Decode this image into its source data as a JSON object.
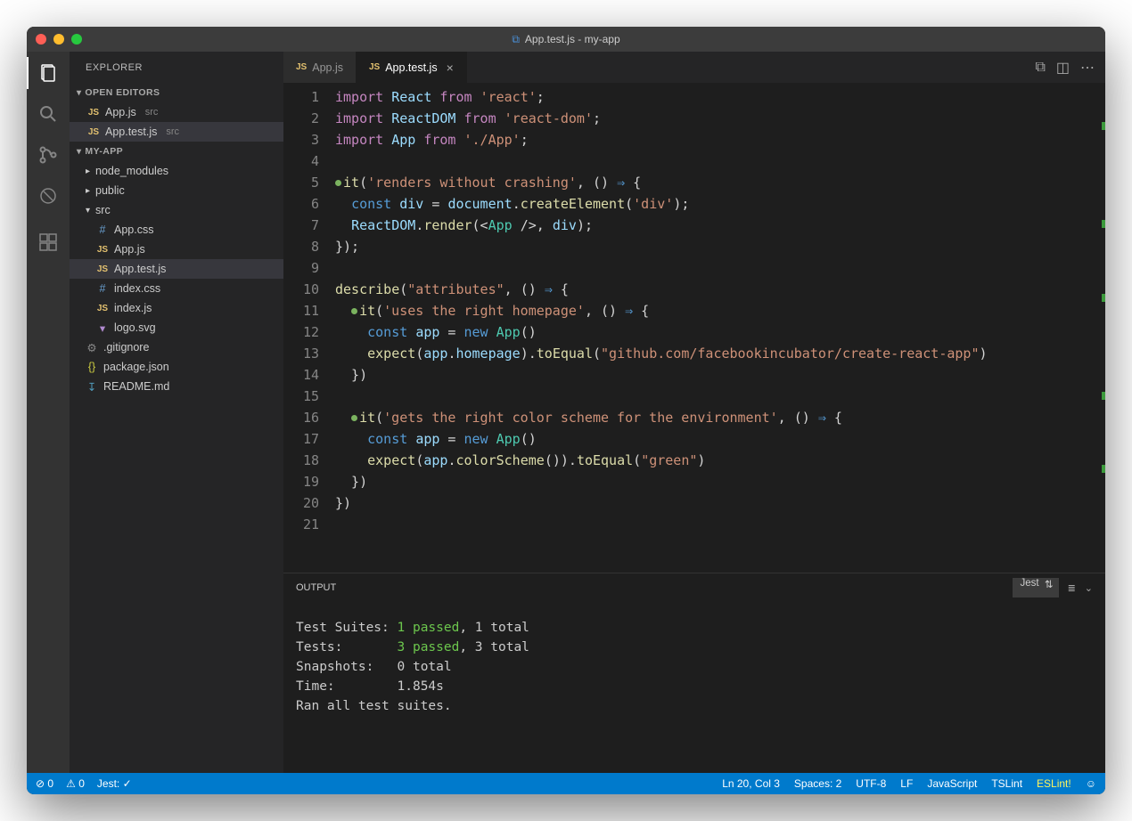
{
  "window": {
    "title": "App.test.js - my-app"
  },
  "sidebar": {
    "header": "EXPLORER",
    "sections": {
      "openEditors": {
        "title": "OPEN EDITORS",
        "items": [
          {
            "icon": "JS",
            "name": "App.js",
            "hint": "src"
          },
          {
            "icon": "JS",
            "name": "App.test.js",
            "hint": "src"
          }
        ]
      },
      "project": {
        "title": "MY-APP",
        "tree": [
          {
            "type": "folder",
            "name": "node_modules",
            "depth": 0
          },
          {
            "type": "folder",
            "name": "public",
            "depth": 0
          },
          {
            "type": "folder",
            "name": "src",
            "depth": 0,
            "open": true
          },
          {
            "type": "file",
            "icon": "#",
            "name": "App.css",
            "depth": 1
          },
          {
            "type": "file",
            "icon": "JS",
            "name": "App.js",
            "depth": 1
          },
          {
            "type": "file",
            "icon": "JS",
            "name": "App.test.js",
            "depth": 1,
            "selected": true
          },
          {
            "type": "file",
            "icon": "#",
            "name": "index.css",
            "depth": 1
          },
          {
            "type": "file",
            "icon": "JS",
            "name": "index.js",
            "depth": 1
          },
          {
            "type": "file",
            "icon": "svg",
            "name": "logo.svg",
            "depth": 1
          },
          {
            "type": "file",
            "icon": "git",
            "name": ".gitignore",
            "depth": 0
          },
          {
            "type": "file",
            "icon": "{}",
            "name": "package.json",
            "depth": 0
          },
          {
            "type": "file",
            "icon": "↓",
            "name": "README.md",
            "depth": 0
          }
        ]
      }
    }
  },
  "tabs": [
    {
      "icon": "JS",
      "label": "App.js",
      "active": false
    },
    {
      "icon": "JS",
      "label": "App.test.js",
      "active": true
    }
  ],
  "code": {
    "lines": [
      [
        {
          "c": "k-import",
          "t": "import"
        },
        {
          "t": " "
        },
        {
          "c": "k-var",
          "t": "React"
        },
        {
          "t": " "
        },
        {
          "c": "k-import",
          "t": "from"
        },
        {
          "t": " "
        },
        {
          "c": "k-str",
          "t": "'react'"
        },
        {
          "t": ";"
        }
      ],
      [
        {
          "c": "k-import",
          "t": "import"
        },
        {
          "t": " "
        },
        {
          "c": "k-var",
          "t": "ReactDOM"
        },
        {
          "t": " "
        },
        {
          "c": "k-import",
          "t": "from"
        },
        {
          "t": " "
        },
        {
          "c": "k-str",
          "t": "'react-dom'"
        },
        {
          "t": ";"
        }
      ],
      [
        {
          "c": "k-import",
          "t": "import"
        },
        {
          "t": " "
        },
        {
          "c": "k-var",
          "t": "App"
        },
        {
          "t": " "
        },
        {
          "c": "k-import",
          "t": "from"
        },
        {
          "t": " "
        },
        {
          "c": "k-str",
          "t": "'./App'"
        },
        {
          "t": ";"
        }
      ],
      [],
      [
        {
          "dot": true
        },
        {
          "c": "k-fn",
          "t": "it"
        },
        {
          "t": "("
        },
        {
          "c": "k-str",
          "t": "'renders without crashing'"
        },
        {
          "t": ", () "
        },
        {
          "c": "k-kw",
          "t": "⇒"
        },
        {
          "t": " {"
        }
      ],
      [
        {
          "t": "  "
        },
        {
          "c": "k-kw",
          "t": "const"
        },
        {
          "t": " "
        },
        {
          "c": "k-var",
          "t": "div"
        },
        {
          "t": " = "
        },
        {
          "c": "k-var",
          "t": "document"
        },
        {
          "t": "."
        },
        {
          "c": "k-fn",
          "t": "createElement"
        },
        {
          "t": "("
        },
        {
          "c": "k-str",
          "t": "'div'"
        },
        {
          "t": ");"
        }
      ],
      [
        {
          "t": "  "
        },
        {
          "c": "k-var",
          "t": "ReactDOM"
        },
        {
          "t": "."
        },
        {
          "c": "k-fn",
          "t": "render"
        },
        {
          "t": "(<"
        },
        {
          "c": "k-tag",
          "t": "App"
        },
        {
          "t": " />, "
        },
        {
          "c": "k-var",
          "t": "div"
        },
        {
          "t": ");"
        }
      ],
      [
        {
          "t": "});"
        }
      ],
      [],
      [
        {
          "c": "k-fn",
          "t": "describe"
        },
        {
          "t": "("
        },
        {
          "c": "k-str",
          "t": "\"attributes\""
        },
        {
          "t": ", () "
        },
        {
          "c": "k-kw",
          "t": "⇒"
        },
        {
          "t": " {"
        }
      ],
      [
        {
          "t": "  "
        },
        {
          "dot": true
        },
        {
          "c": "k-fn",
          "t": "it"
        },
        {
          "t": "("
        },
        {
          "c": "k-str",
          "t": "'uses the right homepage'"
        },
        {
          "t": ", () "
        },
        {
          "c": "k-kw",
          "t": "⇒"
        },
        {
          "t": " {"
        }
      ],
      [
        {
          "t": "    "
        },
        {
          "c": "k-kw",
          "t": "const"
        },
        {
          "t": " "
        },
        {
          "c": "k-var",
          "t": "app"
        },
        {
          "t": " = "
        },
        {
          "c": "k-kw",
          "t": "new"
        },
        {
          "t": " "
        },
        {
          "c": "k-type",
          "t": "App"
        },
        {
          "t": "()"
        }
      ],
      [
        {
          "t": "    "
        },
        {
          "c": "k-fn",
          "t": "expect"
        },
        {
          "t": "("
        },
        {
          "c": "k-var",
          "t": "app"
        },
        {
          "t": "."
        },
        {
          "c": "k-var",
          "t": "homepage"
        },
        {
          "t": ")."
        },
        {
          "c": "k-fn",
          "t": "toEqual"
        },
        {
          "t": "("
        },
        {
          "c": "k-str",
          "t": "\"github.com/facebookincubator/create-react-app\""
        },
        {
          "t": ")"
        }
      ],
      [
        {
          "t": "  })"
        }
      ],
      [],
      [
        {
          "t": "  "
        },
        {
          "dot": true
        },
        {
          "c": "k-fn",
          "t": "it"
        },
        {
          "t": "("
        },
        {
          "c": "k-str",
          "t": "'gets the right color scheme for the environment'"
        },
        {
          "t": ", () "
        },
        {
          "c": "k-kw",
          "t": "⇒"
        },
        {
          "t": " {"
        }
      ],
      [
        {
          "t": "    "
        },
        {
          "c": "k-kw",
          "t": "const"
        },
        {
          "t": " "
        },
        {
          "c": "k-var",
          "t": "app"
        },
        {
          "t": " = "
        },
        {
          "c": "k-kw",
          "t": "new"
        },
        {
          "t": " "
        },
        {
          "c": "k-type",
          "t": "App"
        },
        {
          "t": "()"
        }
      ],
      [
        {
          "t": "    "
        },
        {
          "c": "k-fn",
          "t": "expect"
        },
        {
          "t": "("
        },
        {
          "c": "k-var",
          "t": "app"
        },
        {
          "t": "."
        },
        {
          "c": "k-fn",
          "t": "colorScheme"
        },
        {
          "t": "())."
        },
        {
          "c": "k-fn",
          "t": "toEqual"
        },
        {
          "t": "("
        },
        {
          "c": "k-str",
          "t": "\"green\""
        },
        {
          "t": ")"
        }
      ],
      [
        {
          "t": "  })"
        }
      ],
      [
        {
          "t": "})"
        }
      ],
      []
    ]
  },
  "output": {
    "title": "OUTPUT",
    "channel": "Jest",
    "lines": [
      {
        "label": "Test Suites: ",
        "pass": "1 passed",
        "rest": ", 1 total"
      },
      {
        "label": "Tests:       ",
        "pass": "3 passed",
        "rest": ", 3 total"
      },
      {
        "label": "Snapshots:   ",
        "rest": "0 total"
      },
      {
        "label": "Time:        ",
        "rest": "1.854s"
      },
      {
        "label": "Ran all test suites."
      }
    ]
  },
  "status": {
    "errors": "0",
    "warnings": "0",
    "jest": "Jest: ✓",
    "pos": "Ln 20, Col 3",
    "spaces": "Spaces: 2",
    "enc": "UTF-8",
    "eol": "LF",
    "lang": "JavaScript",
    "tslint": "TSLint",
    "eslint": "ESLint!",
    "smile": "☺"
  }
}
